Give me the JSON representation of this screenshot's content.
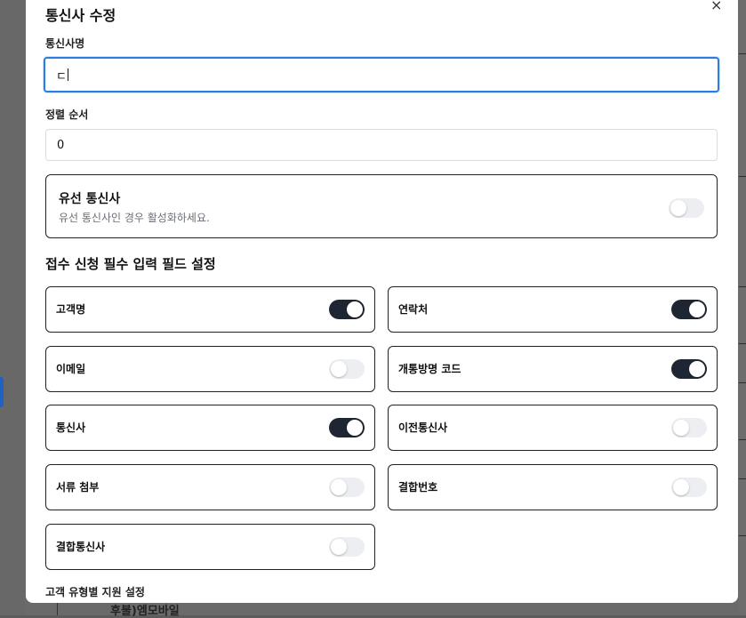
{
  "modal": {
    "title": "통신사 수정",
    "close_glyph": "×"
  },
  "name_field": {
    "label": "통신사명",
    "value": "ㄷ"
  },
  "order_field": {
    "label": "정렬 순서",
    "value": "0"
  },
  "wired": {
    "title": "유선 통신사",
    "description": "유선 통신사인 경우 활성화하세요.",
    "enabled": false
  },
  "required_section": {
    "title": "접수 신청 필수 입력 필드 설정",
    "fields": [
      {
        "label": "고객명",
        "enabled": true
      },
      {
        "label": "연락처",
        "enabled": true
      },
      {
        "label": "이메일",
        "enabled": false
      },
      {
        "label": "개통방명 코드",
        "enabled": true
      },
      {
        "label": "통신사",
        "enabled": true
      },
      {
        "label": "이전통신사",
        "enabled": false
      },
      {
        "label": "서류 첨부",
        "enabled": false
      },
      {
        "label": "결합번호",
        "enabled": false
      },
      {
        "label": "결합통신사",
        "enabled": false
      }
    ]
  },
  "customer_type_section": {
    "title": "고객 유형별 지원 설정"
  },
  "background": {
    "partial_text": "후불)엠모바일"
  }
}
